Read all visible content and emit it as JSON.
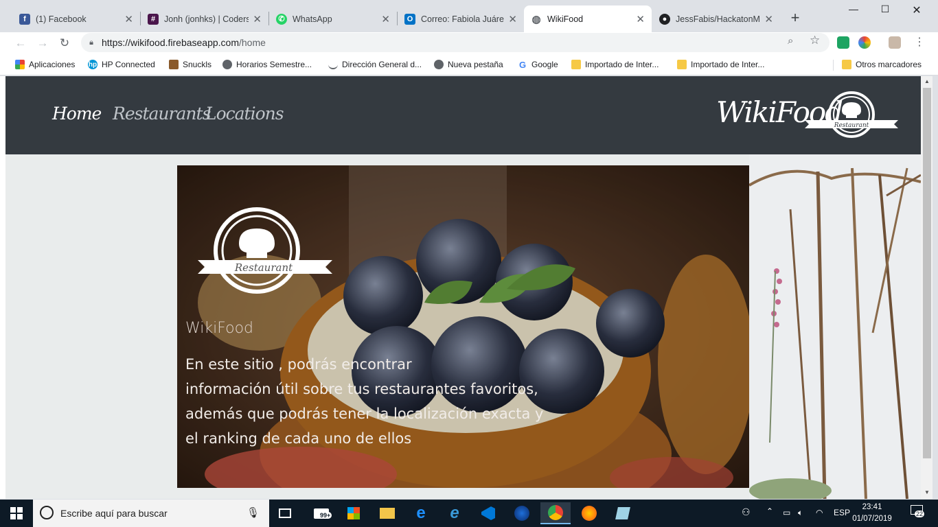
{
  "browser": {
    "tabs": [
      {
        "title": "(1) Facebook",
        "icon": "facebook-icon",
        "color": "#3b5998"
      },
      {
        "title": "Jonh (jonhks) | Coders L",
        "icon": "slack-icon",
        "color": "#4a154b"
      },
      {
        "title": "WhatsApp",
        "icon": "whatsapp-icon",
        "color": "#25d366"
      },
      {
        "title": "Correo: Fabiola Juárez J",
        "icon": "outlook-icon",
        "color": "#0072c6"
      },
      {
        "title": "WikiFood",
        "icon": "globe-icon",
        "color": "#5f6368"
      },
      {
        "title": "JessFabis/HackatonMo",
        "icon": "github-icon",
        "color": "#202124"
      }
    ],
    "url_host": "https://wikifood.firebaseapp.com",
    "url_path": "/home",
    "bookmarks": [
      {
        "label": "Aplicaciones",
        "icon": "apps-grid-icon"
      },
      {
        "label": "HP Connected",
        "icon": "hp-icon"
      },
      {
        "label": "Snuckls",
        "icon": "snuckls-icon"
      },
      {
        "label": "Horarios Semestre...",
        "icon": "globe-icon"
      },
      {
        "label": "Dirección General d...",
        "icon": "swoosh-icon"
      },
      {
        "label": "Nueva pestaña",
        "icon": "globe-icon"
      },
      {
        "label": "Google",
        "icon": "google-icon"
      },
      {
        "label": "Importado de Inter...",
        "icon": "folder-icon"
      },
      {
        "label": "Importado de Inter...",
        "icon": "folder-icon"
      }
    ],
    "other_bookmarks": "Otros marcadores"
  },
  "site": {
    "nav": [
      "Home",
      "Restaurants",
      "Locations"
    ],
    "brand": "WikiFood",
    "logo_text": "Restaurant",
    "hero": {
      "title": "WikiFood",
      "lines": [
        "En este sitio , podrás encontrar",
        "información útil sobre tus restaurantes favoritos,",
        "además que podrás tener la localización exacta y",
        "el ranking de cada uno de ellos"
      ]
    }
  },
  "taskbar": {
    "search_placeholder": "Escribe aquí para buscar",
    "badge": "99+",
    "lang": "ESP",
    "time": "23:41",
    "date": "01/07/2019",
    "notifications": "22"
  }
}
